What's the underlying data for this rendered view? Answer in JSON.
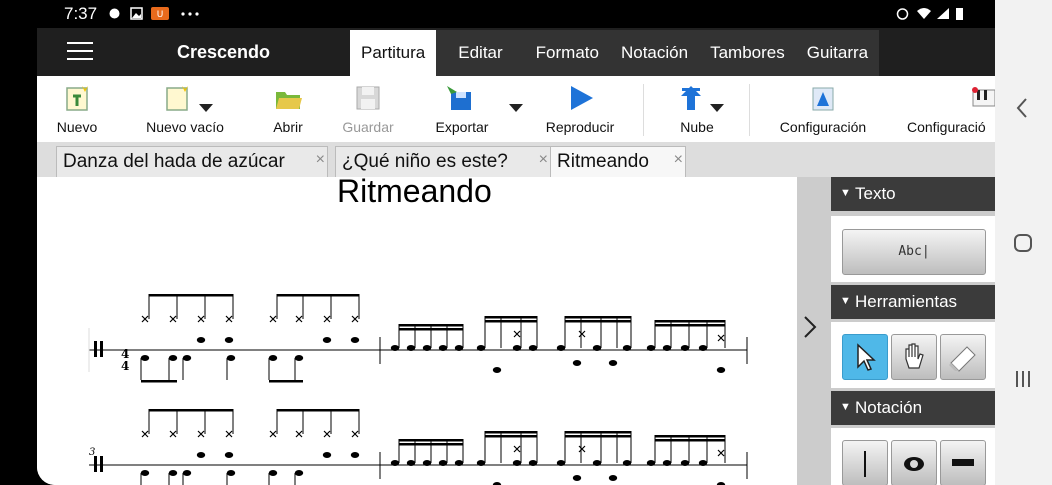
{
  "status": {
    "time": "7:37"
  },
  "app": {
    "title": "Crescendo",
    "tabs": [
      "Partitura",
      "Editar",
      "Formato",
      "Notación",
      "Tambores",
      "Guitarra"
    ],
    "active_tab": "Partitura"
  },
  "toolbar": {
    "nuevo": "Nuevo",
    "nuevo_vacio": "Nuevo vacío",
    "abrir": "Abrir",
    "guardar": "Guardar",
    "exportar": "Exportar",
    "reproducir": "Reproducir",
    "nube": "Nube",
    "configuracion1": "Configuración",
    "configuracion2": "Configuració"
  },
  "documents": [
    {
      "label": "Danza del hada de azúcar",
      "close": "×"
    },
    {
      "label": "¿Qué niño es este?",
      "close": "×"
    },
    {
      "label": "Ritmeando",
      "close": "×"
    }
  ],
  "score": {
    "title": "Ritmeando",
    "time_signature": [
      "4",
      "4"
    ],
    "measure_number": "3"
  },
  "panel": {
    "texto": "Texto",
    "abc": "Abc|",
    "herramientas": "Herramientas",
    "notacion": "Notación"
  },
  "colors": {
    "accent": "#4fb8e8",
    "appbar": "#1f1f1f",
    "play": "#1e73d8"
  },
  "icons": [
    "menu-icon",
    "new-icon",
    "new-blank-icon",
    "open-folder-icon",
    "save-icon",
    "export-icon",
    "play-icon",
    "cloud-upload-icon",
    "settings-icon",
    "pointer-icon",
    "hand-icon",
    "eraser-icon",
    "bar-line-icon",
    "whole-note-icon",
    "rest-icon"
  ]
}
